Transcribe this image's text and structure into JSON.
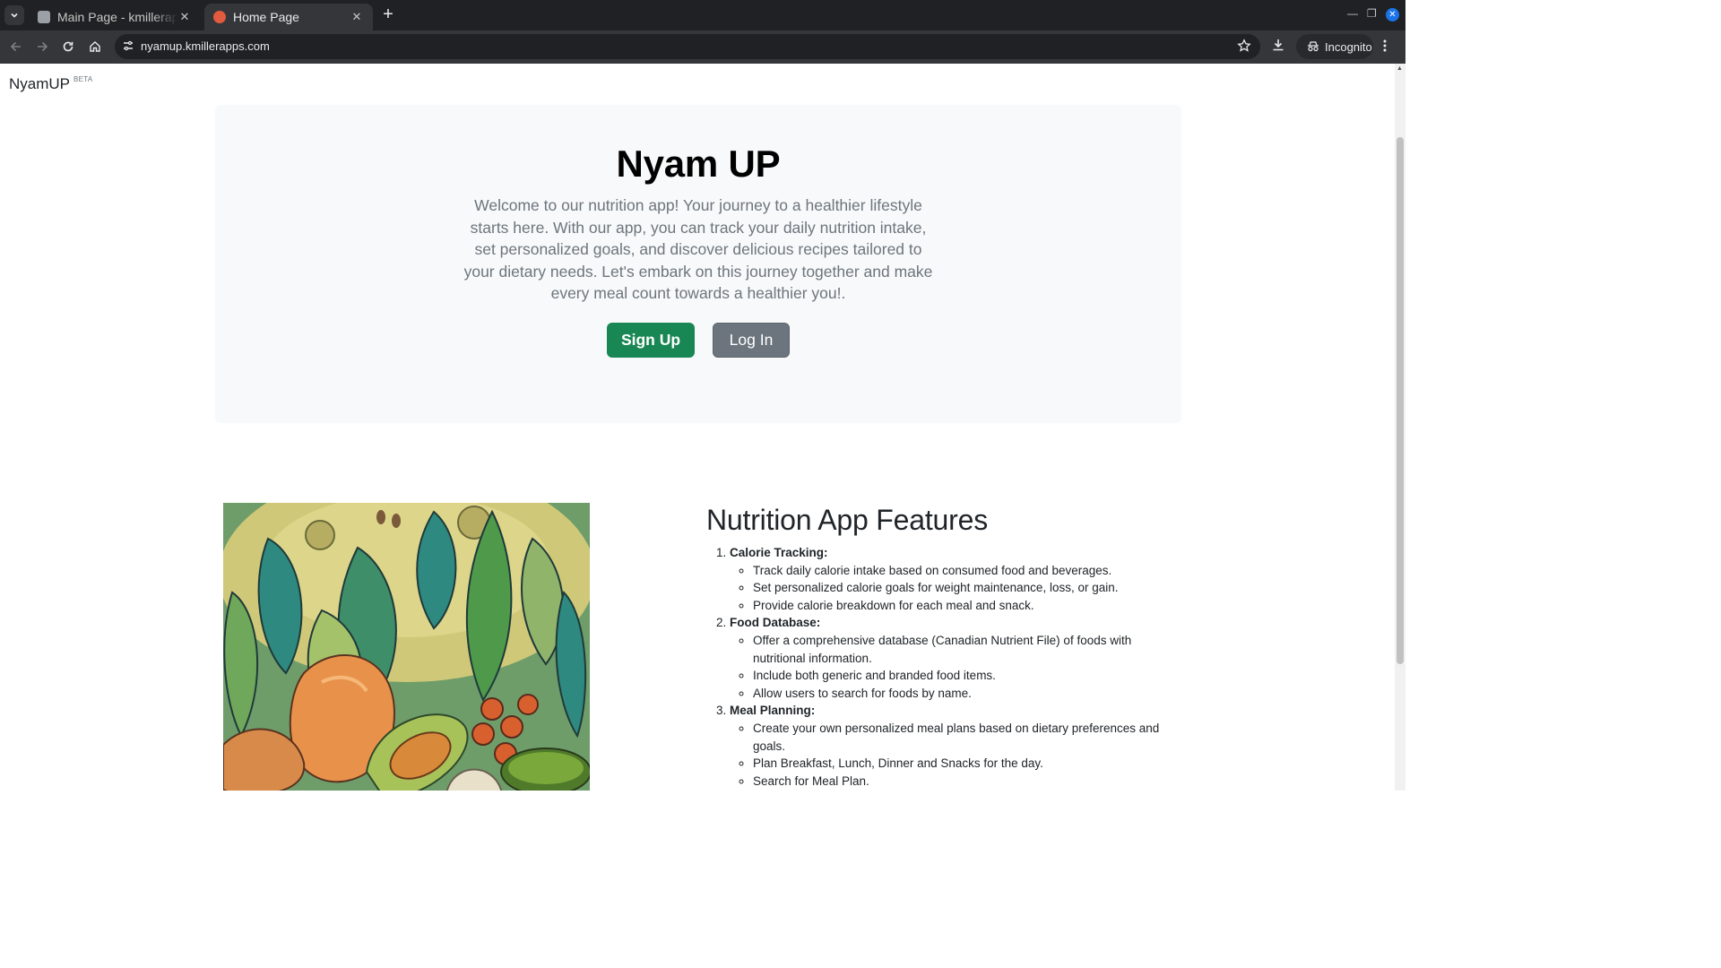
{
  "browser": {
    "tabs": [
      {
        "title": "Main Page - kmillerapps",
        "active": false
      },
      {
        "title": "Home Page",
        "active": true
      }
    ],
    "url": "nyamup.kmillerapps.com",
    "incognito_label": "Incognito"
  },
  "navbar": {
    "brand": "NyamUP",
    "badge": "BETA"
  },
  "hero": {
    "title": "Nyam UP",
    "description": "Welcome to our nutrition app! Your journey to a healthier lifestyle starts here. With our app, you can track your daily nutrition intake, set personalized goals, and discover delicious recipes tailored to your dietary needs. Let's embark on this journey together and make every meal count towards a healthier you!.",
    "signup_label": "Sign Up",
    "login_label": "Log In"
  },
  "features": {
    "title": "Nutrition App Features",
    "items": [
      {
        "heading": "Calorie Tracking:",
        "points": [
          "Track daily calorie intake based on consumed food and beverages.",
          "Set personalized calorie goals for weight maintenance, loss, or gain.",
          "Provide calorie breakdown for each meal and snack."
        ]
      },
      {
        "heading": "Food Database:",
        "points": [
          "Offer a comprehensive database (Canadian Nutrient File) of foods with nutritional information.",
          "Include both generic and branded food items.",
          "Allow users to search for foods by name."
        ]
      },
      {
        "heading": "Meal Planning:",
        "points": [
          "Create your own personalized meal plans based on dietary preferences and goals.",
          "Plan Breakfast, Lunch, Dinner and Snacks for the day.",
          "Search for Meal Plan."
        ]
      }
    ]
  },
  "colors": {
    "primary_success": "#198754",
    "secondary": "#6c757d",
    "hero_bg": "#f8f9fa"
  }
}
